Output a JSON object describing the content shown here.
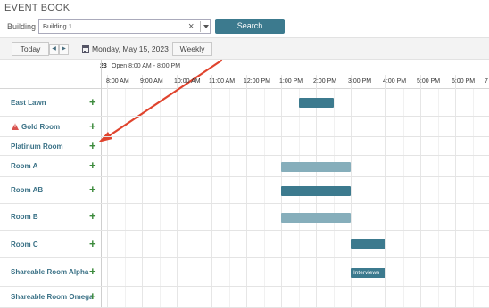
{
  "app": {
    "title": "EVENT BOOK"
  },
  "filter": {
    "building_label": "Building",
    "building_value": "Building 1",
    "clear_glyph": "×",
    "search_label": "Search"
  },
  "toolbar": {
    "today_label": "Today",
    "prev_glyph": "◀",
    "next_glyph": "▶",
    "date_label": "Monday, May 15, 2023",
    "view_label": "Weekly"
  },
  "header": {
    "day_number": "23",
    "open_hours": "Open 8:00 AM - 8:00 PM",
    "hours": [
      "8:00 AM",
      "9:00 AM",
      "10:00 AM",
      "11:00 AM",
      "12:00 PM",
      "1:00 PM",
      "2:00 PM",
      "3:00 PM",
      "4:00 PM",
      "5:00 PM",
      "6:00 PM",
      "7"
    ]
  },
  "rooms": [
    {
      "name": "East Lawn",
      "warning": false,
      "add": "+"
    },
    {
      "name": "Gold Room",
      "warning": true,
      "add": "+"
    },
    {
      "name": "Platinum Room",
      "warning": false,
      "add": "+"
    },
    {
      "name": "Room A",
      "warning": false,
      "add": "+"
    },
    {
      "name": "Room AB",
      "warning": false,
      "add": "+"
    },
    {
      "name": "Room B",
      "warning": false,
      "add": "+"
    },
    {
      "name": "Room C",
      "warning": false,
      "add": "+"
    },
    {
      "name": "Shareable Room Alpha",
      "warning": false,
      "add": "+"
    },
    {
      "name": "Shareable Room Omega",
      "warning": false,
      "add": "+"
    }
  ],
  "events": [
    {
      "room": "East Lawn",
      "start": "1:30 PM",
      "end": "2:30 PM",
      "label": "",
      "color": "#3c7a8e"
    },
    {
      "room": "Room A",
      "start": "1:00 PM",
      "end": "3:00 PM",
      "label": "",
      "color": "#86aebb"
    },
    {
      "room": "Room AB",
      "start": "1:00 PM",
      "end": "3:00 PM",
      "label": "",
      "color": "#3c7a8e"
    },
    {
      "room": "Room B",
      "start": "1:00 PM",
      "end": "3:00 PM",
      "label": "",
      "color": "#86aebb"
    },
    {
      "room": "Room C",
      "start": "3:00 PM",
      "end": "4:00 PM",
      "label": "",
      "color": "#3c7a8e"
    },
    {
      "room": "Shareable Room Alpha",
      "start": "3:00 PM",
      "end": "4:00 PM",
      "label": "Interviews",
      "color": "#3c7a8e"
    }
  ],
  "colors": {
    "accent": "#3c7a8e",
    "add": "#3d8b3d",
    "warning": "#d9534f",
    "annotation_arrow": "#e0442e"
  }
}
